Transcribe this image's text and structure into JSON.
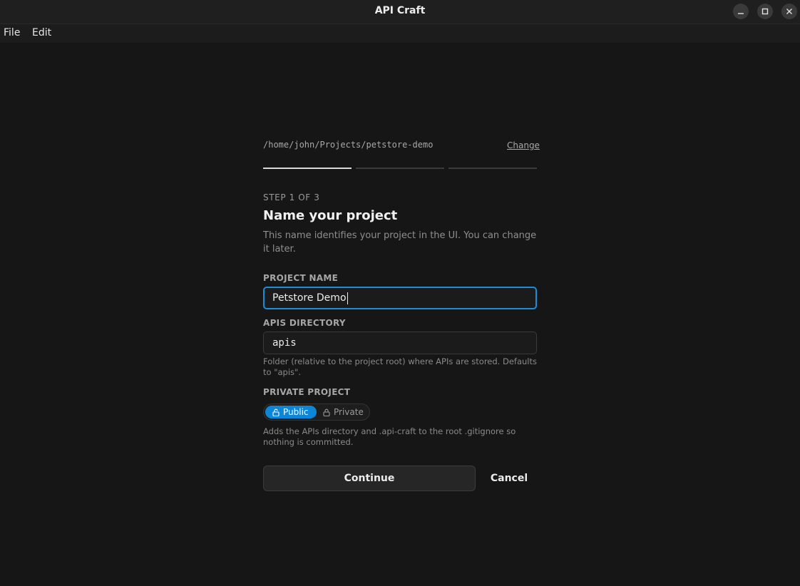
{
  "window": {
    "title": "API Craft",
    "controls": [
      "minimize",
      "maximize",
      "close"
    ]
  },
  "menu": {
    "items": [
      "File",
      "Edit"
    ]
  },
  "wizard": {
    "path": "/home/john/Projects/petstore-demo",
    "change_label": "Change",
    "step_label": "STEP 1 OF 3",
    "current_step": 1,
    "total_steps": 3,
    "heading": "Name your project",
    "description": "This name identifies your project in the UI. You can change it later."
  },
  "fields": {
    "project_name": {
      "label": "PROJECT NAME",
      "value": "Petstore Demo"
    },
    "apis_directory": {
      "label": "APIS DIRECTORY",
      "value": "apis",
      "help": "Folder (relative to the project root) where APIs are stored. Defaults to \"apis\"."
    },
    "private_project": {
      "label": "PRIVATE PROJECT",
      "options": [
        "Public",
        "Private"
      ],
      "selected": "Public",
      "help": "Adds the APIs directory and .api-craft to the root .gitignore so nothing is committed."
    }
  },
  "actions": {
    "continue_label": "Continue",
    "cancel_label": "Cancel"
  },
  "colors": {
    "accent": "#0d86d8",
    "focus_ring": "#1a8fd8",
    "background": "#161616"
  }
}
